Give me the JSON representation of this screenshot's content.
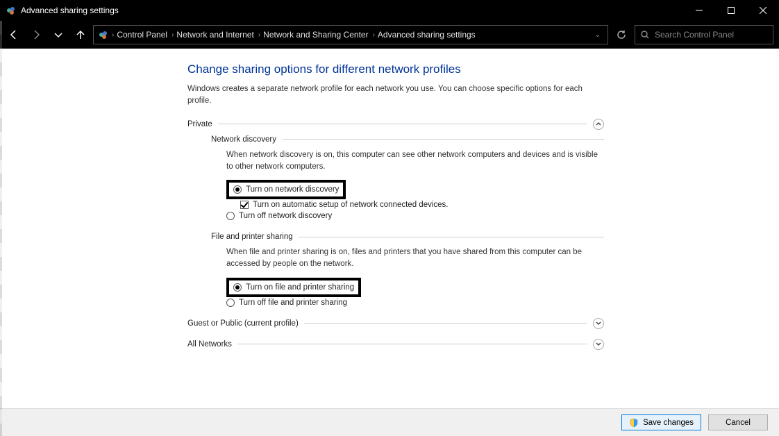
{
  "window": {
    "title": "Advanced sharing settings"
  },
  "breadcrumbs": {
    "b0": "Control Panel",
    "b1": "Network and Internet",
    "b2": "Network and Sharing Center",
    "b3": "Advanced sharing settings"
  },
  "search": {
    "placeholder": "Search Control Panel"
  },
  "page": {
    "title": "Change sharing options for different network profiles",
    "desc": "Windows creates a separate network profile for each network you use. You can choose specific options for each profile."
  },
  "private": {
    "label": "Private",
    "discovery": {
      "title": "Network discovery",
      "desc": "When network discovery is on, this computer can see other network computers and devices and is visible to other network computers.",
      "opt_on": "Turn on network discovery",
      "opt_auto": "Turn on automatic setup of network connected devices.",
      "opt_off": "Turn off network discovery"
    },
    "fps": {
      "title": "File and printer sharing",
      "desc": "When file and printer sharing is on, files and printers that you have shared from this computer can be accessed by people on the network.",
      "opt_on": "Turn on file and printer sharing",
      "opt_off": "Turn off file and printer sharing"
    }
  },
  "guest": {
    "label": "Guest or Public (current profile)"
  },
  "allnet": {
    "label": "All Networks"
  },
  "buttons": {
    "save": "Save changes",
    "cancel": "Cancel"
  }
}
